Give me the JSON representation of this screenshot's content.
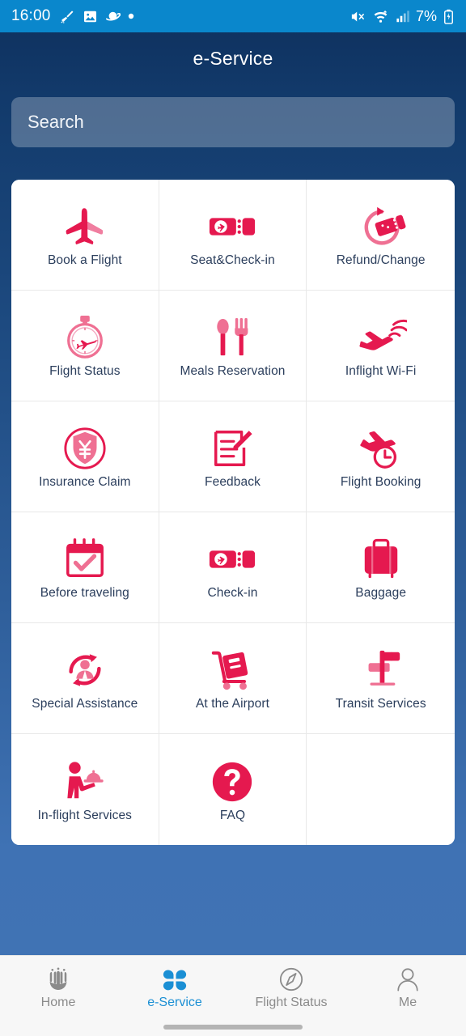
{
  "status_bar": {
    "time": "16:00",
    "battery_percent": "7%",
    "left_icons": [
      "broom-icon",
      "image-icon",
      "saturn-icon",
      "dot-icon"
    ],
    "right_icons": [
      "mute-icon",
      "wifi-icon",
      "signal-icon",
      "battery-icon"
    ],
    "bg_color": "#0a87cc"
  },
  "header": {
    "title": "e-Service"
  },
  "search": {
    "placeholder": "Search",
    "value": ""
  },
  "theme": {
    "accent_pink": "#e5194f",
    "accent_pink_light": "#ef7093",
    "nav_active_blue": "#1b8fd4",
    "label_color": "#2b3e5c",
    "bg_top": "#0e2f5c",
    "bg_bottom": "#4073b4"
  },
  "grid": {
    "items": [
      {
        "label": "Book a Flight",
        "icon": "airplane-up-icon"
      },
      {
        "label": "Seat&Check-in",
        "icon": "ticket-plane-icon"
      },
      {
        "label": "Refund/Change",
        "icon": "refund-ticket-icon"
      },
      {
        "label": "Flight Status",
        "icon": "stopwatch-plane-icon"
      },
      {
        "label": "Meals Reservation",
        "icon": "spoon-fork-icon"
      },
      {
        "label": "Inflight Wi-Fi",
        "icon": "plane-wifi-icon"
      },
      {
        "label": "Insurance Claim",
        "icon": "shield-yen-icon"
      },
      {
        "label": "Feedback",
        "icon": "note-pencil-icon"
      },
      {
        "label": "Flight Booking",
        "icon": "plane-clock-icon"
      },
      {
        "label": "Before traveling",
        "icon": "calendar-check-icon"
      },
      {
        "label": "Check-in",
        "icon": "ticket-plane-icon"
      },
      {
        "label": "Baggage",
        "icon": "suitcase-icon"
      },
      {
        "label": "Special Assistance",
        "icon": "person-arrows-icon"
      },
      {
        "label": "At the Airport",
        "icon": "luggage-cart-icon"
      },
      {
        "label": "Transit Services",
        "icon": "signpost-icon"
      },
      {
        "label": "In-flight Services",
        "icon": "waiter-tray-icon"
      },
      {
        "label": "FAQ",
        "icon": "question-circle-icon"
      },
      {
        "label": "",
        "icon": ""
      }
    ]
  },
  "bottom_nav": {
    "items": [
      {
        "label": "Home",
        "icon": "airline-logo-icon",
        "active": false
      },
      {
        "label": "e-Service",
        "icon": "clover-grid-icon",
        "active": true
      },
      {
        "label": "Flight Status",
        "icon": "compass-icon",
        "active": false
      },
      {
        "label": "Me",
        "icon": "person-icon",
        "active": false
      }
    ]
  }
}
